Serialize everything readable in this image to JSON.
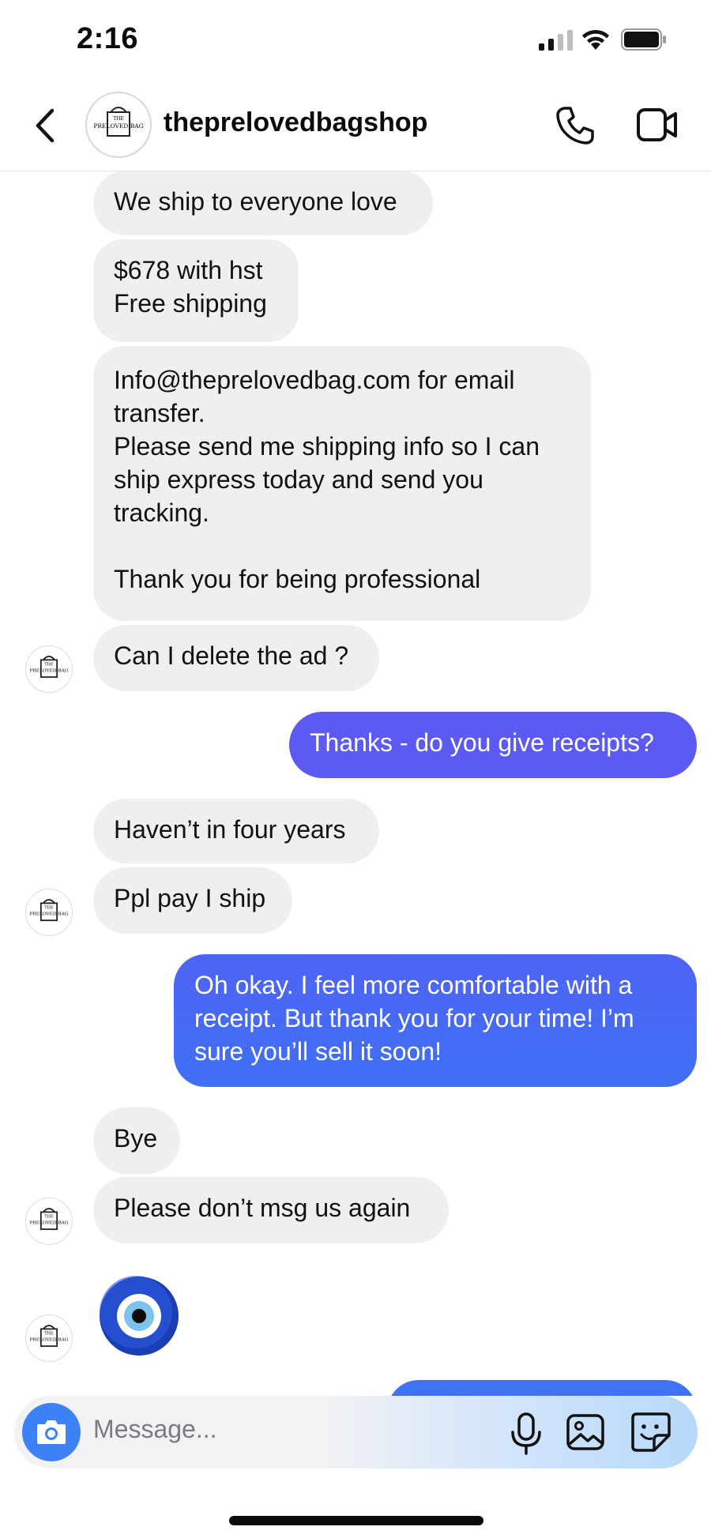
{
  "status_bar": {
    "time": "2:16"
  },
  "header": {
    "name": "theprelovedbagshop",
    "avatar_text": [
      "THE",
      "PRELOVED BAG"
    ]
  },
  "messages": [
    {
      "dir": "in",
      "text": "We ship to everyone love"
    },
    {
      "dir": "in",
      "text": "$678 with hst\nFree shipping"
    },
    {
      "dir": "in",
      "text": "Info@theprelovedbag.com for email transfer.\nPlease send me shipping info so I can ship express today and send you tracking.\n\nThank you for being professional"
    },
    {
      "dir": "in",
      "text": "Can I delete the ad ?"
    },
    {
      "dir": "out",
      "text": "Thanks - do you give receipts?"
    },
    {
      "dir": "in",
      "text": "Haven’t in four years"
    },
    {
      "dir": "in",
      "text": "Ppl pay I ship"
    },
    {
      "dir": "out",
      "text": "Oh okay. I feel more comfortable with a receipt. But thank you for your time! I’m sure you’ll sell it soon!"
    },
    {
      "dir": "in",
      "text": "Bye"
    },
    {
      "dir": "in",
      "text": "Please don’t msg us again"
    },
    {
      "dir": "in",
      "sticker": "evil-eye-emoji"
    }
  ],
  "composer": {
    "placeholder": "Message..."
  },
  "colors": {
    "outgoing_top": "#5d5af3",
    "outgoing_bottom": "#3f6ff5",
    "incoming": "#efefef",
    "camera": "#3c82f6"
  }
}
